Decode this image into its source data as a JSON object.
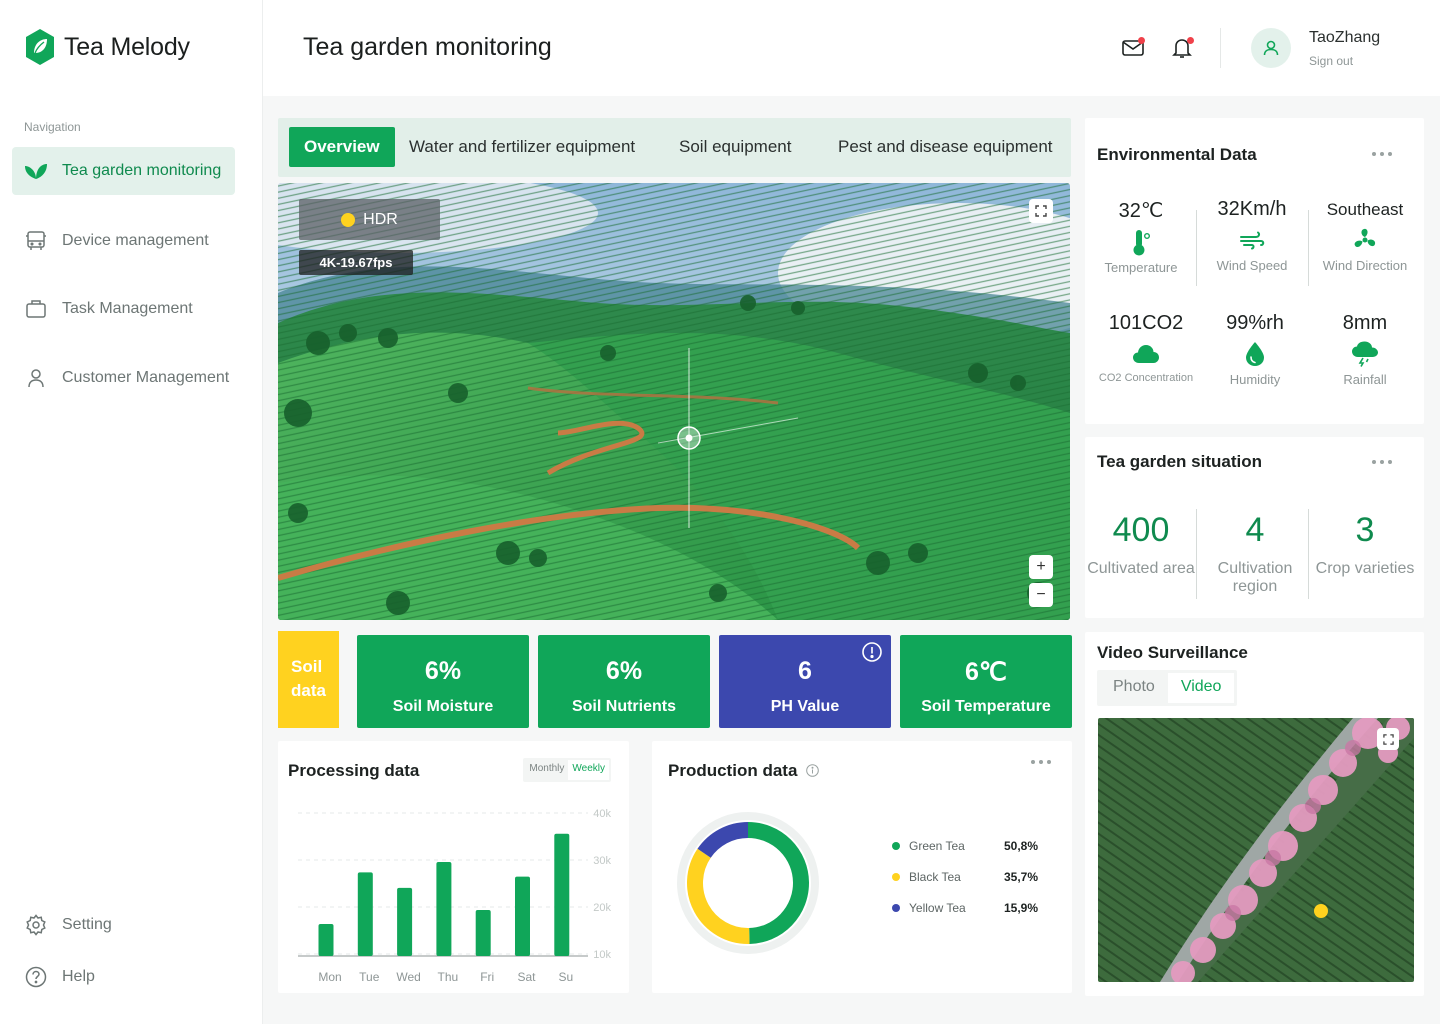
{
  "app": {
    "name": "Tea Melody"
  },
  "sidebar": {
    "caption": "Navigation",
    "items": [
      {
        "label": "Tea garden monitoring",
        "icon": "leaf-icon",
        "active": true
      },
      {
        "label": "Device management",
        "icon": "bus-icon"
      },
      {
        "label": "Task Management",
        "icon": "briefcase-icon"
      },
      {
        "label": "Customer Management",
        "icon": "user-icon"
      }
    ],
    "bottom": [
      {
        "label": "Setting",
        "icon": "gear-icon"
      },
      {
        "label": "Help",
        "icon": "help-icon"
      }
    ]
  },
  "header": {
    "title": "Tea garden monitoring",
    "user": {
      "name": "TaoZhang",
      "sign_out": "Sign out"
    }
  },
  "tabs": [
    "Overview",
    "Water and fertilizer equipment",
    "Soil equipment",
    "Pest and disease equipment"
  ],
  "camera": {
    "hdr": "HDR",
    "resolution": "4K-19.67fps",
    "zoom_in": "+",
    "zoom_out": "−"
  },
  "soil": {
    "label_line1": "Soil",
    "label_line2": "data",
    "cards": [
      {
        "value": "6%",
        "label": "Soil Moisture",
        "color": "#10a659"
      },
      {
        "value": "6%",
        "label": "Soil Nutrients",
        "color": "#10a659"
      },
      {
        "value": "6",
        "label": "PH Value",
        "color": "#3c48ae"
      },
      {
        "value": "6℃",
        "label": "Soil Temperature",
        "color": "#10a659"
      }
    ]
  },
  "processing": {
    "title": "Processing data",
    "toggle": [
      "Monthly",
      "Weekly"
    ],
    "active_toggle": "Weekly"
  },
  "production": {
    "title": "Production data",
    "legend": [
      {
        "name": "Green Tea",
        "pct": "50,8%",
        "color": "#10a659"
      },
      {
        "name": "Black Tea",
        "pct": "35,7%",
        "color": "#ffd21f"
      },
      {
        "name": "Yellow Tea",
        "pct": "15,9%",
        "color": "#3c48ae"
      }
    ]
  },
  "environmental": {
    "title": "Environmental Data",
    "items": [
      {
        "value": "32℃",
        "label": "Temperature",
        "icon": "thermometer-icon"
      },
      {
        "value": "32Km/h",
        "label": "Wind Speed",
        "icon": "wind-icon"
      },
      {
        "value": "Southeast",
        "label": "Wind Direction",
        "icon": "fan-icon"
      },
      {
        "value": "101CO2",
        "label": "CO2 Concentration",
        "icon": "cloud-icon"
      },
      {
        "value": "99%rh",
        "label": "Humidity",
        "icon": "drop-icon"
      },
      {
        "value": "8mm",
        "label": "Rainfall",
        "icon": "rain-icon"
      }
    ]
  },
  "situation": {
    "title": "Tea garden situation",
    "items": [
      {
        "value": "400",
        "label": "Cultivated area"
      },
      {
        "value": "4",
        "label": "Cultivation region"
      },
      {
        "value": "3",
        "label": "Crop varieties"
      }
    ]
  },
  "video": {
    "title": "Video Surveillance",
    "tabs": [
      "Photo",
      "Video"
    ],
    "active_tab": "Video"
  },
  "chart_data": [
    {
      "type": "bar",
      "title": "Processing data",
      "categories": [
        "Mon",
        "Tue",
        "Wed",
        "Thu",
        "Fri",
        "Sat",
        "Su"
      ],
      "values": [
        16800,
        27800,
        24500,
        30000,
        19800,
        26900,
        36000
      ],
      "y_ticks": [
        "40k",
        "30k",
        "20k",
        "10k"
      ],
      "ylim": [
        10000,
        40000
      ],
      "color": "#10a659"
    },
    {
      "type": "pie",
      "title": "Production data",
      "labels": [
        "Green Tea",
        "Black Tea",
        "Yellow Tea"
      ],
      "values": [
        50.8,
        35.7,
        15.9
      ],
      "colors": [
        "#10a659",
        "#ffd21f",
        "#3c48ae"
      ]
    }
  ]
}
